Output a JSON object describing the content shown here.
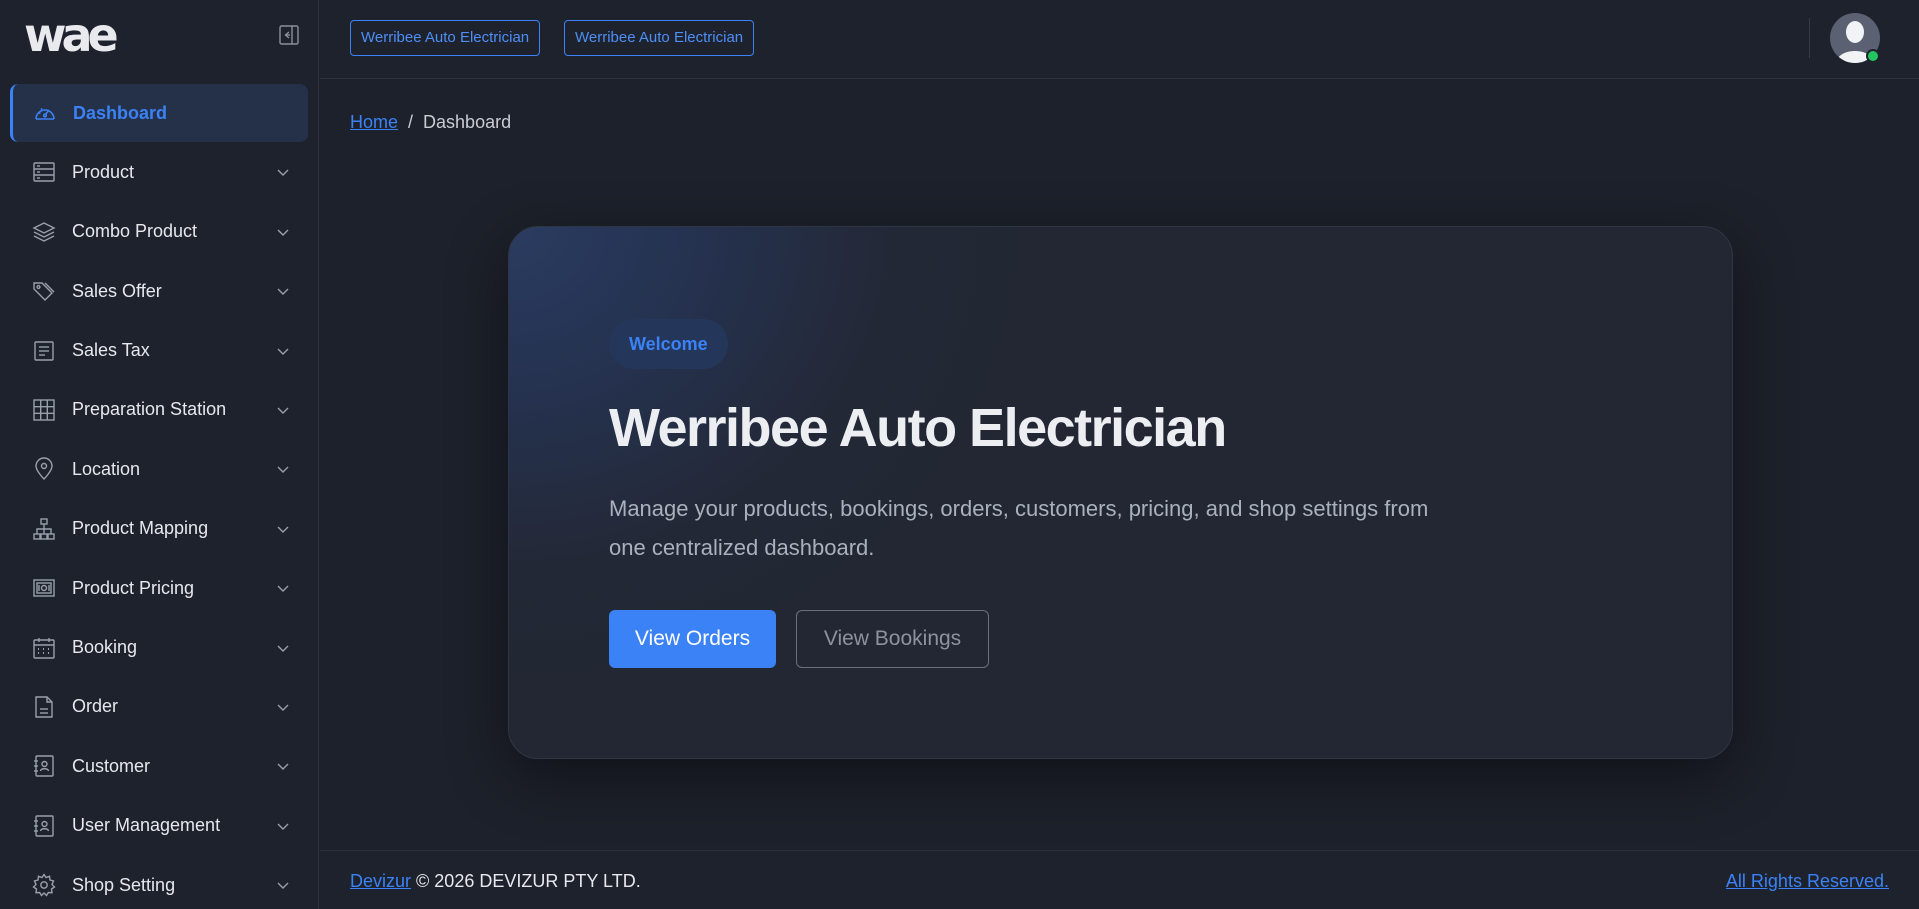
{
  "brand": {
    "logo_text": "wae"
  },
  "sidebar": {
    "items": [
      {
        "label": "Dashboard",
        "icon": "dashboard-gauge-icon",
        "active": true
      },
      {
        "label": "Product",
        "icon": "product-list-icon"
      },
      {
        "label": "Combo Product",
        "icon": "layers-icon"
      },
      {
        "label": "Sales Offer",
        "icon": "tags-icon"
      },
      {
        "label": "Sales Tax",
        "icon": "document-lines-icon"
      },
      {
        "label": "Preparation Station",
        "icon": "grid-icon"
      },
      {
        "label": "Location",
        "icon": "map-pin-icon"
      },
      {
        "label": "Product Mapping",
        "icon": "sitemap-icon"
      },
      {
        "label": "Product Pricing",
        "icon": "money-icon"
      },
      {
        "label": "Booking",
        "icon": "calendar-icon"
      },
      {
        "label": "Order",
        "icon": "file-icon"
      },
      {
        "label": "Customer",
        "icon": "contact-book-icon"
      },
      {
        "label": "User Management",
        "icon": "contact-book-icon"
      },
      {
        "label": "Shop Setting",
        "icon": "gear-icon"
      }
    ]
  },
  "header": {
    "tags": [
      "Werribee Auto Electrician",
      "Werribee Auto Electrician"
    ]
  },
  "breadcrumb": {
    "home": "Home",
    "separator": "/",
    "current": "Dashboard"
  },
  "hero": {
    "badge": "Welcome",
    "title": "Werribee Auto Electrician",
    "description": "Manage your products, bookings, orders, customers, pricing, and shop settings from one centralized dashboard.",
    "primary_button": "View Orders",
    "secondary_button": "View Bookings"
  },
  "footer": {
    "company_link": "Devizur",
    "copyright": "© 2026 DEVIZUR PTY LTD.",
    "rights": "All Rights Reserved."
  },
  "colors": {
    "accent": "#3b82f6",
    "background": "#1d212b",
    "panel": "#1e222c",
    "online": "#22c55e"
  }
}
